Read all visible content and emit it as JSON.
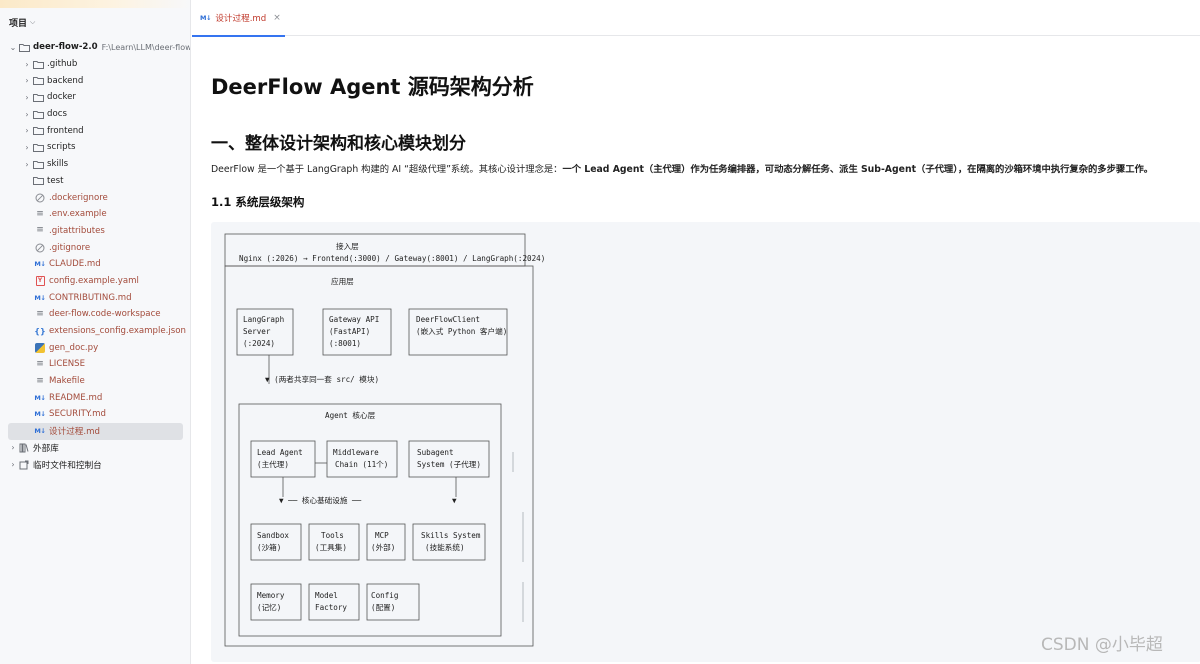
{
  "project_panel": {
    "title": "项目",
    "root": {
      "name": "deer-flow-2.0",
      "path": "F:\\Learn\\LLM\\deer-flow"
    },
    "folders": [
      ".github",
      "backend",
      "docker",
      "docs",
      "frontend",
      "scripts",
      "skills"
    ],
    "test_folder": "test",
    "files": [
      {
        "name": ".dockerignore",
        "icon": "ignore-icon"
      },
      {
        "name": ".env.example",
        "icon": "text-file-icon"
      },
      {
        "name": ".gitattributes",
        "icon": "text-file-icon"
      },
      {
        "name": ".gitignore",
        "icon": "ignore-icon"
      },
      {
        "name": "CLAUDE.md",
        "icon": "markdown-icon"
      },
      {
        "name": "config.example.yaml",
        "icon": "config-icon"
      },
      {
        "name": "CONTRIBUTING.md",
        "icon": "markdown-icon"
      },
      {
        "name": "deer-flow.code-workspace",
        "icon": "text-file-icon"
      },
      {
        "name": "extensions_config.example.json",
        "icon": "json-icon"
      },
      {
        "name": "gen_doc.py",
        "icon": "python-icon"
      },
      {
        "name": "LICENSE",
        "icon": "text-file-icon"
      },
      {
        "name": "Makefile",
        "icon": "text-file-icon"
      },
      {
        "name": "README.md",
        "icon": "markdown-icon"
      },
      {
        "name": "SECURITY.md",
        "icon": "markdown-icon"
      },
      {
        "name": "设计过程.md",
        "icon": "markdown-icon"
      }
    ],
    "external_libraries": "外部库",
    "scratches": "临时文件和控制台"
  },
  "tab": {
    "label": "设计过程.md",
    "close": "×",
    "badge": "M↓"
  },
  "doc": {
    "h1": "DeerFlow Agent 源码架构分析",
    "h2": "一、整体设计架构和核心模块划分",
    "para_start": "DeerFlow 是一个基于 LangGraph 构建的 AI “超级代理”系统。其核心设计理念是：",
    "para_bold_1": "一个 Lead Agent（主代理）作为任务编排器，可动态分解任务、派生 Sub-Agent（子代理），在隔离的沙箱环境中执行复杂的多步骤工作。",
    "h3": "1.1 系统层级架构"
  },
  "diagram": {
    "access_layer": "接入层",
    "access_line": "Nginx (:2026) → Frontend(:3000) / Gateway(:8001) / LangGraph(:2024)",
    "app_layer": "应用层",
    "langgraph": [
      "LangGraph",
      "Server",
      "(:2024)"
    ],
    "gateway": [
      "Gateway API",
      "(FastAPI)",
      "(:8001)"
    ],
    "client": [
      "DeerFlowClient",
      "(嵌入式 Python 客户端)"
    ],
    "shared_note": "▼ (两者共享同一套 src/ 模块)",
    "core_layer": "Agent 核心层",
    "lead_agent": [
      "Lead Agent",
      "(主代理)"
    ],
    "middleware": [
      "Middleware",
      "Chain (11个)"
    ],
    "subagent": [
      "Subagent",
      "System (子代理)"
    ],
    "infra": "▼ ── 核心基础设施 ──",
    "down_arrow": "▼",
    "sandbox": [
      "Sandbox",
      "(沙箱)"
    ],
    "tools": [
      "Tools",
      "(工具集)"
    ],
    "mcp": [
      "MCP",
      "(外部)"
    ],
    "skills": [
      "Skills System",
      "(技能系统)"
    ],
    "memory": [
      "Memory",
      "(记忆)"
    ],
    "model": [
      "Model",
      "Factory"
    ],
    "config": [
      "Config",
      "(配置)"
    ]
  },
  "watermark": "CSDN @小毕超"
}
